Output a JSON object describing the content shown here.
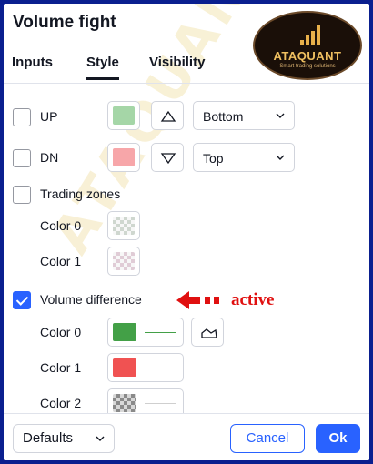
{
  "dialog": {
    "title": "Volume fight"
  },
  "tabs": [
    {
      "label": "Inputs",
      "active": false
    },
    {
      "label": "Style",
      "active": true
    },
    {
      "label": "Visibility",
      "active": false
    }
  ],
  "logo": {
    "name": "ATAQUANT",
    "tagline": "Smart trading solutions",
    "watermark": "ATAQUANT"
  },
  "style": {
    "up": {
      "label": "UP",
      "checked": false,
      "color": "#a5d6a7",
      "shape_icon": "triangle-up-icon",
      "location": "Bottom"
    },
    "dn": {
      "label": "DN",
      "checked": false,
      "color": "#f7a6a9",
      "shape_icon": "triangle-down-icon",
      "location": "Top"
    },
    "trading_zones": {
      "label": "Trading zones",
      "checked": false,
      "color0_label": "Color 0",
      "color1_label": "Color 1"
    },
    "volume_difference": {
      "label": "Volume difference",
      "checked": true,
      "color0_label": "Color 0",
      "color0": "#43a047",
      "color1_label": "Color 1",
      "color1": "#f05252",
      "color2_label": "Color 2",
      "color2": "#8a8a8a",
      "plot_type_icon": "area-chart-icon"
    }
  },
  "annotation": {
    "text": "active",
    "color": "#e01010"
  },
  "footer": {
    "defaults_label": "Defaults",
    "cancel_label": "Cancel",
    "ok_label": "Ok"
  }
}
